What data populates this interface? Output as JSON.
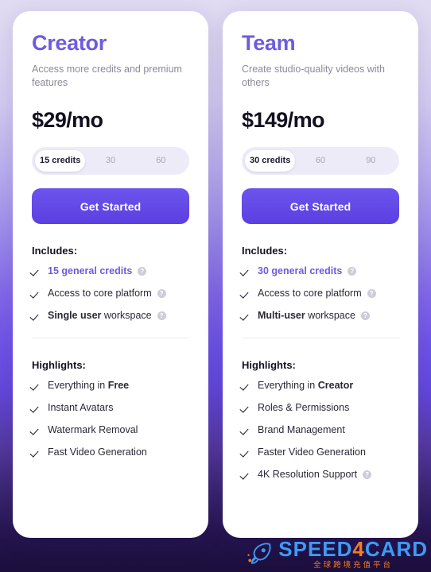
{
  "page": {
    "background_top": "#e0dbf2",
    "background_mid": "#6f54e6",
    "background_bottom": "#1b0e3c",
    "accent_color": "#6c5ce0"
  },
  "plans": [
    {
      "name": "Creator",
      "description": "Access more credits and premium features",
      "price": "$29/mo",
      "credit_options": [
        "15 credits",
        "30",
        "60"
      ],
      "credit_selected_index": 0,
      "cta_label": "Get Started",
      "includes_title": "Includes:",
      "includes": [
        {
          "text": "15 general credits",
          "accent": true,
          "info": true
        },
        {
          "text": "Access to core platform",
          "accent": false,
          "info": true
        },
        {
          "bold_prefix": "Single user",
          "text": " workspace",
          "accent": false,
          "info": true
        }
      ],
      "highlights_title": "Highlights:",
      "highlights": [
        {
          "text": "Everything in ",
          "bold_suffix": "Free",
          "info": false
        },
        {
          "text": "Instant Avatars",
          "info": false
        },
        {
          "text": "Watermark Removal",
          "info": false
        },
        {
          "text": "Fast Video Generation",
          "info": false
        }
      ]
    },
    {
      "name": "Team",
      "description": "Create studio-quality videos with others",
      "price": "$149/mo",
      "credit_options": [
        "30 credits",
        "60",
        "90"
      ],
      "credit_selected_index": 0,
      "cta_label": "Get Started",
      "includes_title": "Includes:",
      "includes": [
        {
          "text": "30 general credits",
          "accent": true,
          "info": true
        },
        {
          "text": "Access to core platform",
          "accent": false,
          "info": true
        },
        {
          "bold_prefix": "Multi-user",
          "text": " workspace",
          "accent": false,
          "info": true
        }
      ],
      "highlights_title": "Highlights:",
      "highlights": [
        {
          "text": "Everything in ",
          "bold_suffix": "Creator",
          "info": false
        },
        {
          "text": "Roles & Permissions",
          "info": false
        },
        {
          "text": "Brand Management",
          "info": false
        },
        {
          "text": "Faster Video Generation",
          "info": false
        },
        {
          "text": "4K Resolution Support",
          "info": true
        }
      ]
    }
  ],
  "watermark": {
    "brand_part1": "SPEED",
    "brand_digit": "4",
    "brand_part2": "CARD",
    "subtitle": "全球跨境充值平台",
    "brand_color": "#3d9bf2",
    "accent_color": "#f57c20"
  },
  "icons": {
    "info": "?",
    "rocket": "rocket-icon"
  }
}
